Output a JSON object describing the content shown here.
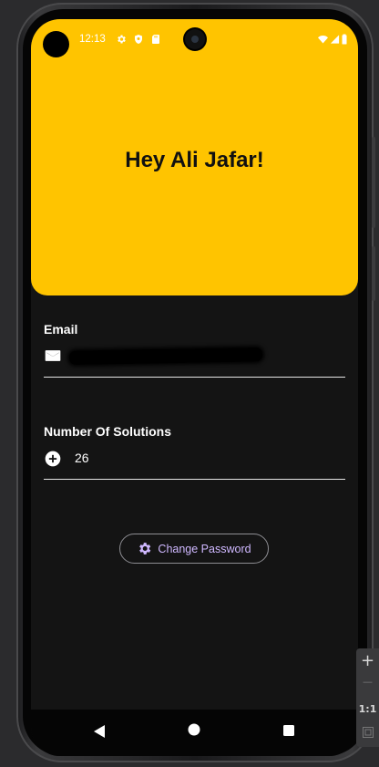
{
  "status_bar": {
    "time": "12:13"
  },
  "header": {
    "greeting": "Hey Ali Jafar!",
    "background_color": "#ffc400"
  },
  "email_field": {
    "label": "Email",
    "value_redacted": true,
    "icon": "mail-icon"
  },
  "solutions_field": {
    "label": "Number Of Solutions",
    "value": "26",
    "icon": "add-circle-icon"
  },
  "change_password_button": {
    "label": "Change Password",
    "icon": "gear-icon",
    "text_color": "#cfb8ff"
  },
  "nav_bar": {
    "back": "back-triangle-icon",
    "home": "home-circle-icon",
    "recents": "recents-square-icon"
  },
  "emulator_toolbar": {
    "zoom_in": "+",
    "zoom_out": "—",
    "ratio": "1:1"
  }
}
